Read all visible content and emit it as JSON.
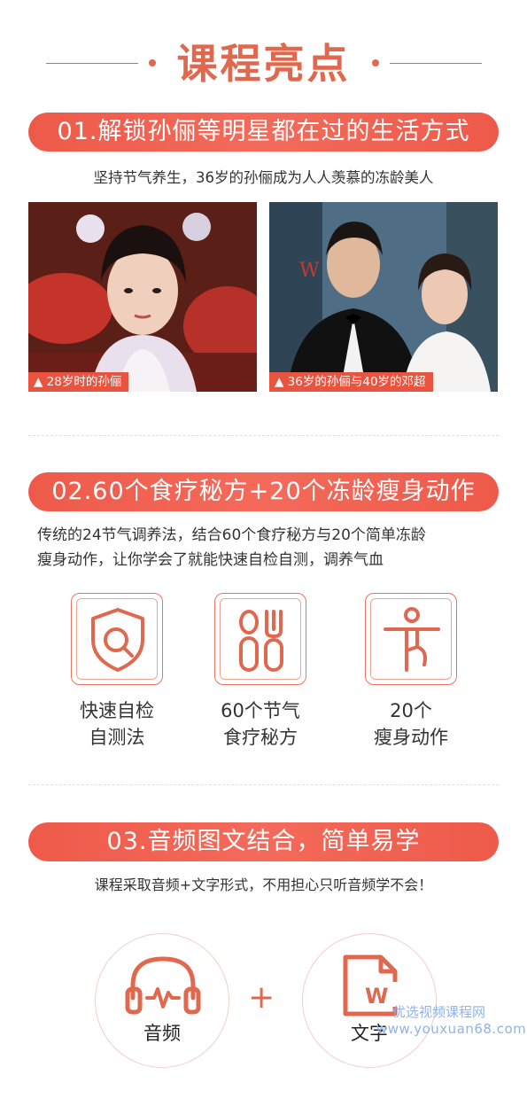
{
  "header": {
    "title": "课程亮点"
  },
  "section1": {
    "heading": "01.解锁孙俪等明星都在过的生活方式",
    "subtitle": "坚持节气养生，36岁的孙俪成为人人羡慕的冻龄美人",
    "photos": [
      {
        "caption": "▲ 28岁时的孙俪"
      },
      {
        "caption": "▲ 36岁的孙俪与40岁的邓超"
      }
    ]
  },
  "section2": {
    "heading": "02.60个食疗秘方+20个冻龄瘦身动作",
    "paragraph_line1": "传统的24节气调养法，结合60个食疗秘方与20个简单冻龄",
    "paragraph_line2": "瘦身动作，让你学会了就能快速自检自测，调养气血",
    "features": [
      {
        "icon": "shield-search-icon",
        "line1": "快速自检",
        "line2": "自测法"
      },
      {
        "icon": "fork-spoon-icon",
        "line1": "60个节气",
        "line2": "食疗秘方"
      },
      {
        "icon": "yoga-pose-icon",
        "line1": "20个",
        "line2": "瘦身动作"
      }
    ]
  },
  "section3": {
    "heading": "03.音频图文结合，简单易学",
    "subtitle": "课程采取音频+文字形式，不用担心只听音频学不会！",
    "items": [
      {
        "icon": "headphones-icon",
        "label": "音频"
      },
      {
        "icon": "document-w-icon",
        "label": "文字"
      }
    ],
    "plus": "+"
  },
  "watermark": {
    "line1": "优选视频课程网",
    "line2": "www.youxuan68.com"
  },
  "colors": {
    "accent": "#e0684f",
    "pill": "#f05e4c",
    "caption": "#e8543f"
  }
}
